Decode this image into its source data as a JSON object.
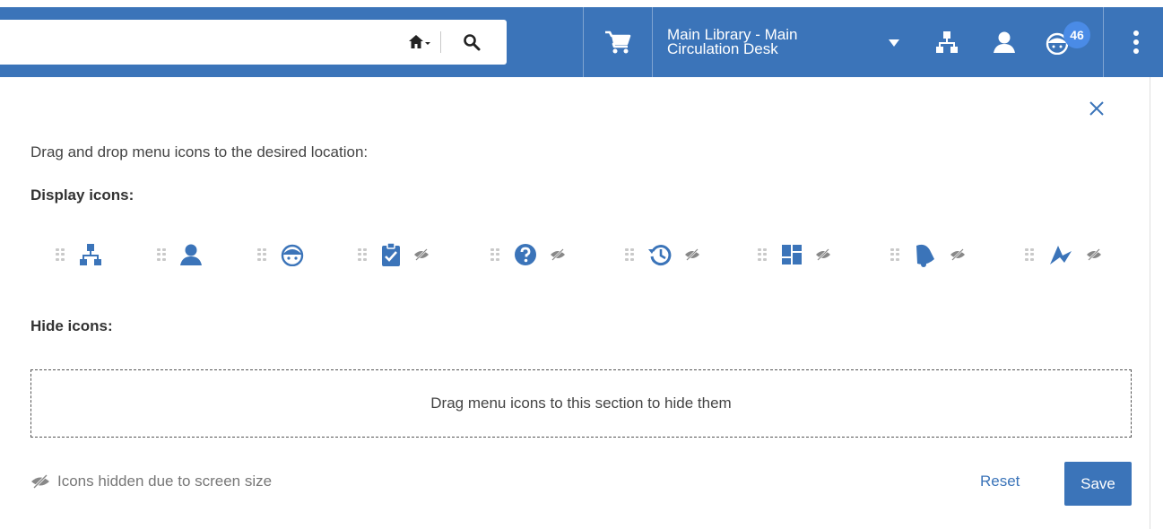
{
  "header": {
    "search": {
      "value": "",
      "placeholder": ""
    },
    "icons": {
      "home": "home-icon",
      "search": "search-icon",
      "cart": "cart-icon",
      "hierarchy": "hierarchy-icon",
      "user": "user-icon",
      "avatar": "avatar-face-icon",
      "more": "more-vertical-icon"
    },
    "library": {
      "line1": "Main Library - Main",
      "line2": "Circulation Desk"
    },
    "notification_count": "46"
  },
  "panel": {
    "instructions": "Drag and drop menu icons to the desired location:",
    "display_label": "Display icons:",
    "hide_label": "Hide icons:",
    "display_icons": [
      {
        "icon": "hierarchy-icon",
        "hidden_on_small_screens": false
      },
      {
        "icon": "user-icon",
        "hidden_on_small_screens": false
      },
      {
        "icon": "avatar-face-icon",
        "hidden_on_small_screens": false
      },
      {
        "icon": "clipboard-check-icon",
        "hidden_on_small_screens": true
      },
      {
        "icon": "help-circle-icon",
        "hidden_on_small_screens": true
      },
      {
        "icon": "history-icon",
        "hidden_on_small_screens": true
      },
      {
        "icon": "dashboard-icon",
        "hidden_on_small_screens": true
      },
      {
        "icon": "bell-icon",
        "hidden_on_small_screens": true
      },
      {
        "icon": "launch-icon",
        "hidden_on_small_screens": true
      }
    ],
    "dropzone_text": "Drag menu icons to this section to hide them",
    "footer_note": "Icons hidden due to screen size",
    "reset_label": "Reset",
    "save_label": "Save"
  },
  "colors": {
    "brand_blue": "#3b74b9",
    "badge_blue": "#4a8be6",
    "icon_gray": "#888888"
  }
}
